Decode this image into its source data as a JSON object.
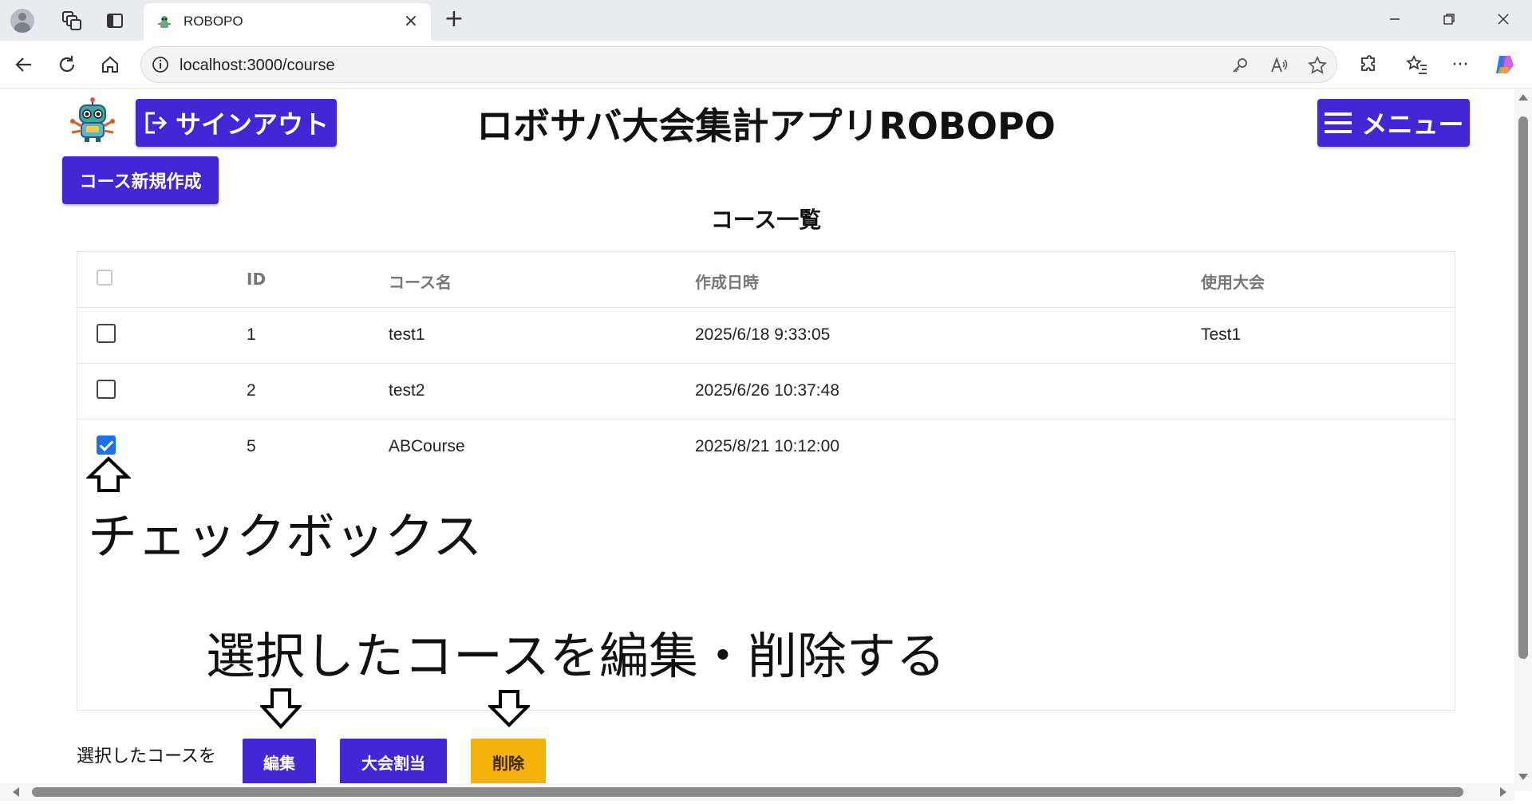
{
  "browser": {
    "tab_title": "ROBOPO",
    "url": "localhost:3000/course",
    "new_tab_symbol": "+",
    "close_symbol": "×",
    "more_symbol": "···"
  },
  "header": {
    "signout_label": "サインアウト",
    "app_title": "ロボサバ大会集計アプリROBOPO",
    "menu_label": "メニュー",
    "new_course_label": "コース新規作成"
  },
  "section_title": "コース一覧",
  "table": {
    "columns": [
      "ID",
      "コース名",
      "作成日時",
      "使用大会"
    ],
    "rows": [
      {
        "id": "1",
        "name": "test1",
        "created": "2025/6/18 9:33:05",
        "competition": "Test1",
        "checked": false
      },
      {
        "id": "2",
        "name": "test2",
        "created": "2025/6/26 10:37:48",
        "competition": "",
        "checked": false
      },
      {
        "id": "5",
        "name": "ABCourse",
        "created": "2025/8/21 10:12:00",
        "competition": "",
        "checked": true
      }
    ]
  },
  "annotations": {
    "checkbox": "チェックボックス",
    "edit_delete": "選択したコースを編集・削除する"
  },
  "footer": {
    "label": "選択したコースを",
    "edit": "編集",
    "assign": "大会割当",
    "delete": "削除"
  },
  "colors": {
    "primary": "#4327d6",
    "warning": "#f5b20a",
    "checkbox_checked": "#1a73e8"
  },
  "icons": [
    "profile-icon",
    "collections-icon",
    "vertical-tabs-icon",
    "back-icon",
    "refresh-icon",
    "home-icon",
    "info-icon",
    "key-icon",
    "read-aloud-icon",
    "favorite-star-icon",
    "extensions-icon",
    "favorites-icon",
    "copilot-icon",
    "signout-icon",
    "hamburger-icon",
    "robot-logo"
  ]
}
